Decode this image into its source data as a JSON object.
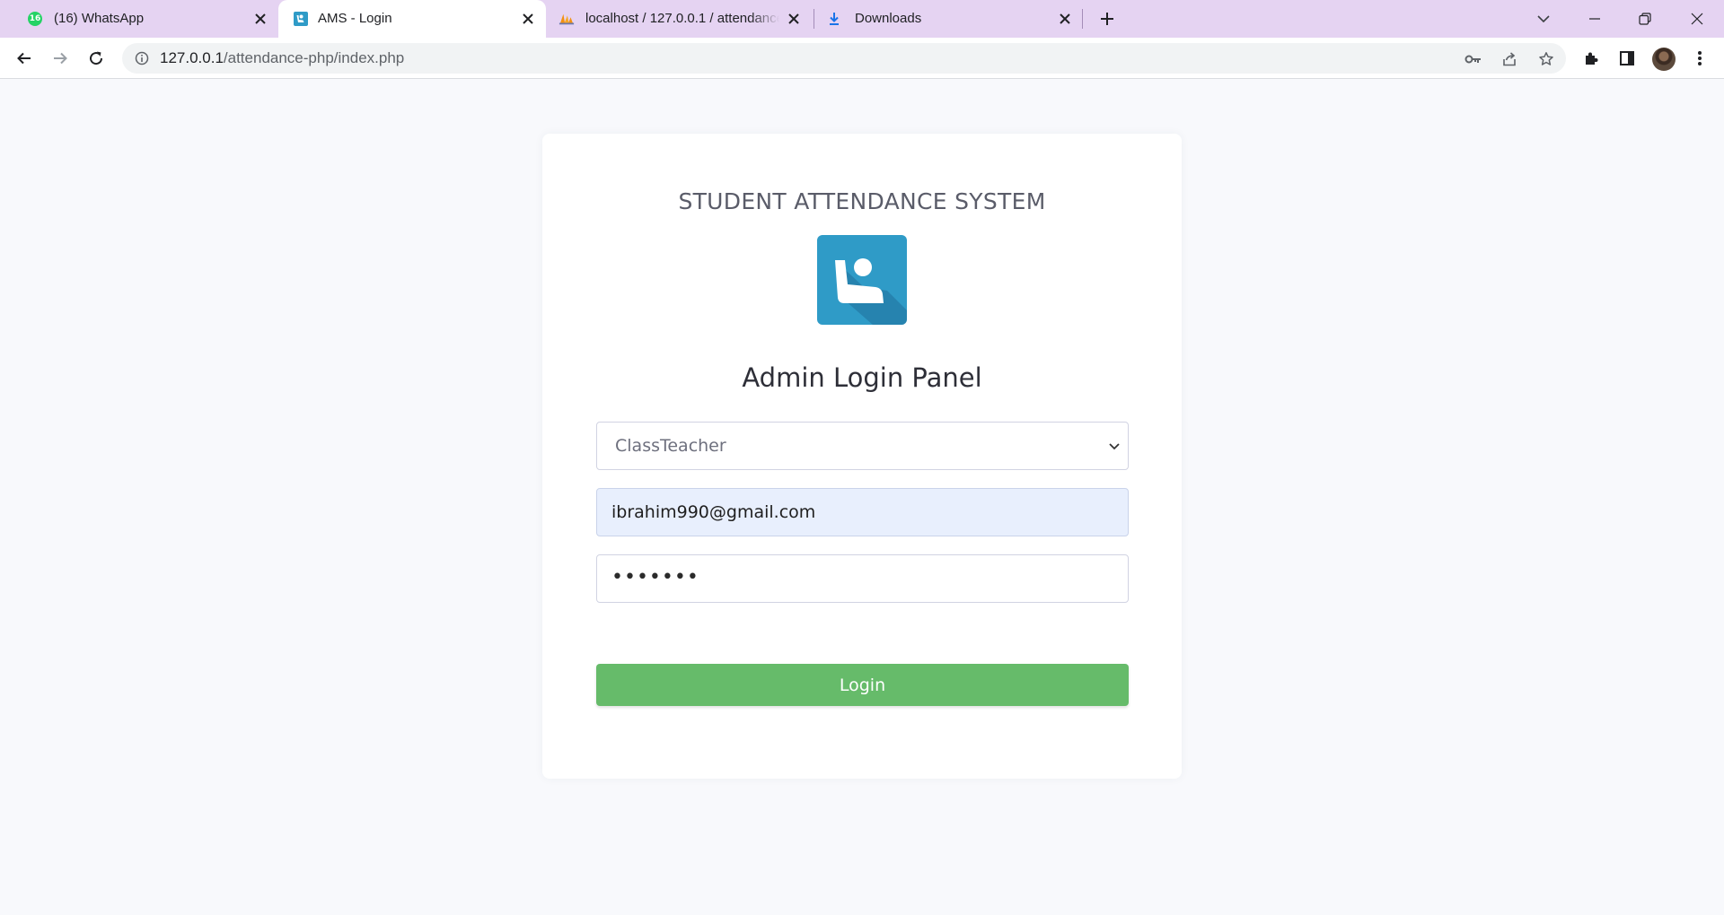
{
  "browser": {
    "tabs": [
      {
        "title": "(16) WhatsApp",
        "badge": "16",
        "icon": "whatsapp-icon"
      },
      {
        "title": "AMS - Login",
        "icon": "ams-favicon"
      },
      {
        "title": "localhost / 127.0.0.1 / attendance",
        "icon": "phpmyadmin-icon"
      },
      {
        "title": "Downloads",
        "icon": "download-icon"
      }
    ],
    "address": {
      "host": "127.0.0.1",
      "path": "/attendance-php/index.php"
    }
  },
  "page": {
    "system_title": "STUDENT ATTENDANCE SYSTEM",
    "panel_title": "Admin Login Panel",
    "role_select": {
      "selected": "ClassTeacher"
    },
    "email": {
      "value": "ibrahim990@gmail.com"
    },
    "password": {
      "masked": "•••••••"
    },
    "login_label": "Login"
  },
  "colors": {
    "tabstrip": "#e5d3f2",
    "logo": "#2f9bc7",
    "login_button": "#66bb6a",
    "autofill": "#e8effd"
  }
}
